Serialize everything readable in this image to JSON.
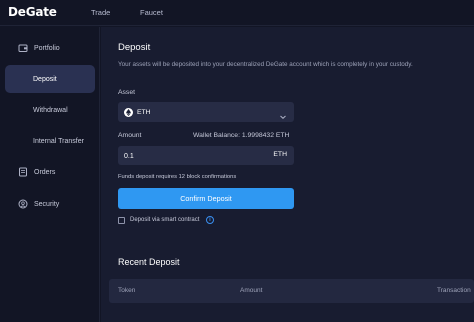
{
  "brand": {
    "name": "DeGate"
  },
  "topnav": {
    "links": [
      "Trade",
      "Faucet"
    ]
  },
  "sidebar": {
    "items": [
      {
        "label": "Portfolio",
        "icon": "wallet-icon"
      },
      {
        "label": "Deposit",
        "icon": ""
      },
      {
        "label": "Withdrawal",
        "icon": ""
      },
      {
        "label": "Internal Transfer",
        "icon": ""
      },
      {
        "label": "Orders",
        "icon": "orders-icon"
      },
      {
        "label": "Security",
        "icon": "security-icon"
      }
    ],
    "active": "Deposit"
  },
  "deposit": {
    "title": "Deposit",
    "subtitle": "Your assets will be deposited into your decentralized DeGate account which is completely in your custody.",
    "asset_label": "Asset",
    "asset_value": "ETH",
    "amount_label": "Amount",
    "wallet_balance": "Wallet Balance: 1.9998432 ETH",
    "amount_value": "0.1",
    "amount_unit": "ETH",
    "confirmations_note": "Funds deposit requires 12 block confirmations",
    "confirm_button": "Confirm Deposit",
    "smart_contract_label": "Deposit via smart contract",
    "smart_contract_checked": false
  },
  "recent": {
    "title": "Recent Deposit",
    "columns": [
      "Token",
      "Amount",
      "Transaction"
    ]
  },
  "colors": {
    "background": "#121525",
    "panel": "#181c30",
    "accent": "#2f98f2",
    "active_nav": "#2a3152"
  }
}
